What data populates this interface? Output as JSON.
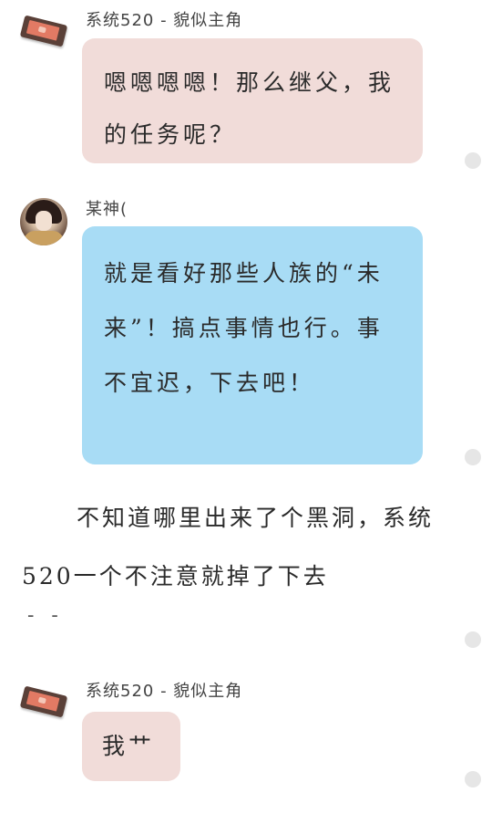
{
  "messages": [
    {
      "sender": "系统520 - 貌似主角",
      "text": "嗯嗯嗯嗯！那么继父，我的任务呢？"
    },
    {
      "sender": "某神(",
      "text": "就是看好那些人族的“未来”！搞点事情也行。事不宜迟，下去吧！"
    },
    {
      "sender": "系统520 - 貌似主角",
      "text": "我艹"
    }
  ],
  "narration": {
    "text": "不知道哪里出来了个黑洞，系统520一个不注意就掉了下去",
    "trail": "- -"
  },
  "colors": {
    "pink_bubble": "#f1dcd9",
    "blue_bubble": "#a8dcf5",
    "dot": "#e6e6e6"
  },
  "icons": {
    "system_avatar": "device-icon",
    "god_avatar": "character-portrait"
  }
}
